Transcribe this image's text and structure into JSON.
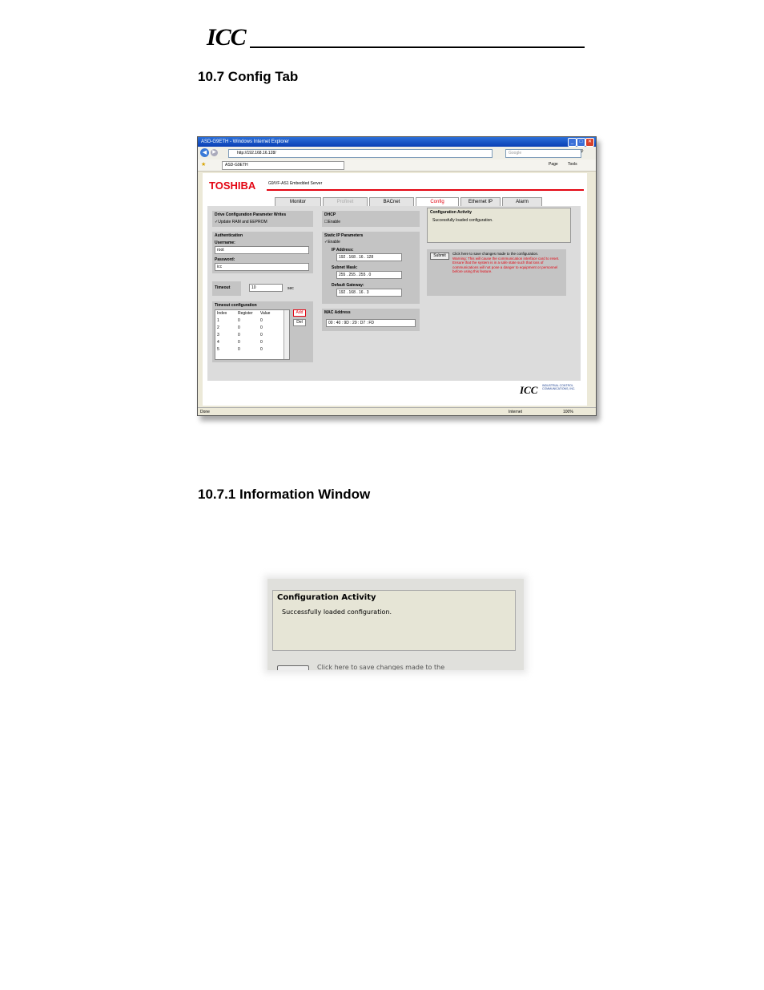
{
  "header": {
    "logo": "ICC"
  },
  "sections": {
    "config_heading": "10.7  Config Tab",
    "info_heading": "10.7.1  Information Window"
  },
  "browser": {
    "title": "ASD-G9ETH - Windows Internet Explorer",
    "address": "http://192.168.16.128/",
    "search_placeholder": "Google",
    "tab_label": "ASD-G9ETH",
    "menu_page": "Page",
    "menu_tools": "Tools",
    "status_left": "Done",
    "status_zone": "Internet",
    "zoom": "100%"
  },
  "app": {
    "brand": "TOSHIBA",
    "server_title": "G9/VF-AS1 Embedded Server",
    "tabs": [
      "Monitor",
      "Profinet",
      "BACnet",
      "Config",
      "Ethernet IP",
      "Alarm"
    ],
    "active_tab": "Config",
    "drive_config": {
      "title": "Drive Configuration Parameter Writes",
      "option": "Update RAM and EEPROM"
    },
    "auth": {
      "title": "Authentication",
      "user_label": "Username:",
      "user_value": "root",
      "pass_label": "Password:",
      "pass_value": "icc"
    },
    "timeout": {
      "label": "Timeout",
      "value": "10",
      "unit": "sec"
    },
    "timeout_config": {
      "title": "Timeout configuration",
      "headers": [
        "Index",
        "Register",
        "Value"
      ],
      "rows": [
        [
          "1",
          "0",
          "0"
        ],
        [
          "2",
          "0",
          "0"
        ],
        [
          "3",
          "0",
          "0"
        ],
        [
          "4",
          "0",
          "0"
        ],
        [
          "5",
          "0",
          "0"
        ]
      ],
      "add": "Add",
      "del": "Del"
    },
    "dhcp": {
      "title": "DHCP",
      "option": "Enable"
    },
    "static_ip": {
      "title": "Static IP Parameters",
      "option": "Enable",
      "ip_label": "IP Address:",
      "ip": [
        "192",
        "168",
        "16",
        "128"
      ],
      "mask_label": "Subnet Mask:",
      "mask": [
        "255",
        "255",
        "255",
        "0"
      ],
      "gw_label": "Default Gateway:",
      "gw": [
        "192",
        "168",
        "16",
        "3"
      ]
    },
    "mac": {
      "title": "MAC Address",
      "octets": [
        "00",
        "40",
        "9D",
        "29",
        "D7",
        "FD"
      ]
    },
    "activity": {
      "title": "Configuration Activity",
      "message": "Successfully loaded configuration."
    },
    "submit": {
      "button": "Submit",
      "text": "Click here to save changes made to the configuration.",
      "warning": "Warning: This will cause the communication interface card to reset. Ensure that the system is in a safe state such that loss of communications will not pose a danger to equipment or personnel before using this feature."
    },
    "footer_logo": "ICC",
    "footer_company": "INDUSTRIAL CONTROL COMMUNICATIONS, INC."
  },
  "crop": {
    "title": "Configuration Activity",
    "message": "Successfully loaded configuration.",
    "save_text": "Click here to save changes made to the"
  }
}
